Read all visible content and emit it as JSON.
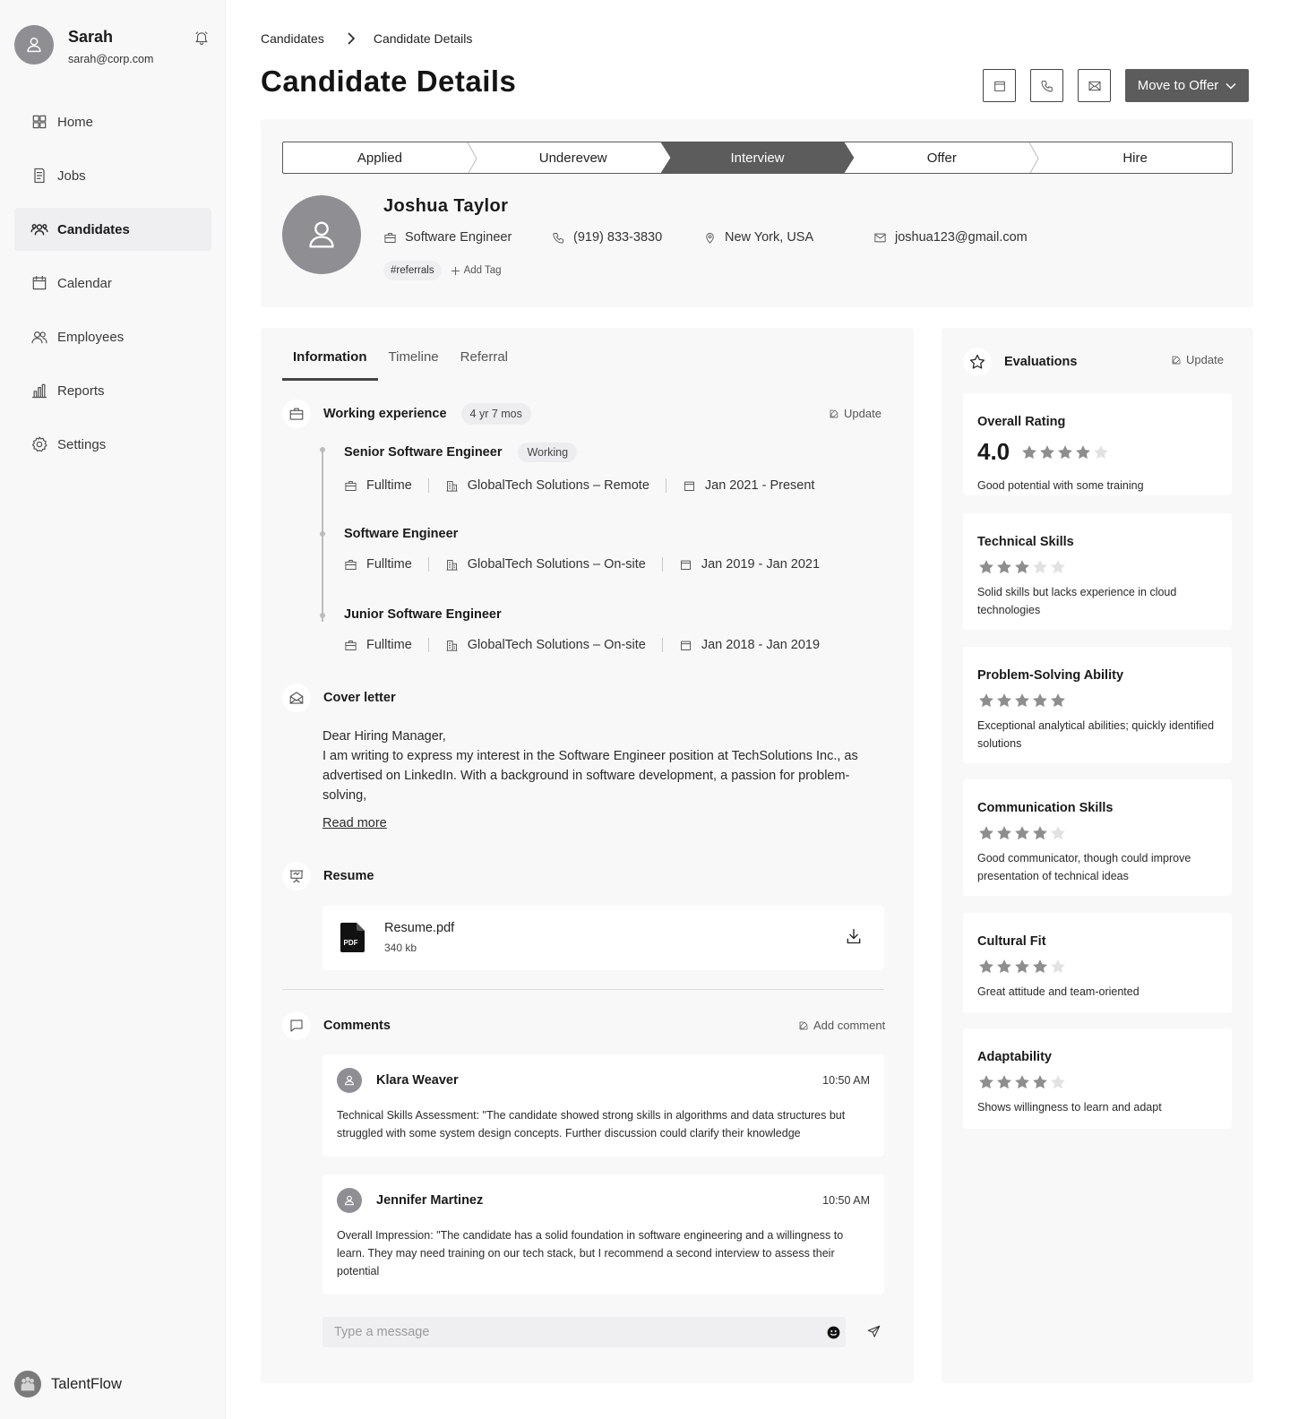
{
  "user": {
    "name": "Sarah",
    "email": "sarah@corp.com",
    "avatar_icon": "user-icon",
    "notification_icon": "bell-icon"
  },
  "nav": {
    "items": [
      {
        "label": "Home",
        "icon": "grid-icon",
        "active": false
      },
      {
        "label": "Jobs",
        "icon": "document-icon",
        "active": false
      },
      {
        "label": "Candidates",
        "icon": "users-icon",
        "active": true
      },
      {
        "label": "Calendar",
        "icon": "calendar-icon",
        "active": false
      },
      {
        "label": "Employees",
        "icon": "people-icon",
        "active": false
      },
      {
        "label": "Reports",
        "icon": "bar-chart-icon",
        "active": false
      },
      {
        "label": "Settings",
        "icon": "gear-icon",
        "active": false
      }
    ]
  },
  "brand": {
    "name": "TalentFlow"
  },
  "breadcrumb": {
    "parent": "Candidates",
    "current": "Candidate Details"
  },
  "page": {
    "title": "Candidate Details"
  },
  "actions": {
    "primary_label": "Move to Offer",
    "icons": [
      "calendar-icon",
      "phone-icon",
      "mail-icon"
    ]
  },
  "stages": {
    "items": [
      "Applied",
      "Underevew",
      "Interview",
      "Offer",
      "Hire"
    ],
    "active": "Interview"
  },
  "candidate": {
    "name": "Joshua Taylor",
    "role": "Software Engineer",
    "phone": "(919) 833-3830",
    "location": "New York, USA",
    "email": "joshua123@gmail.com",
    "tags": [
      "#referrals"
    ],
    "add_tag_label": "Add Tag"
  },
  "tabs": {
    "items": [
      "Information",
      "Timeline",
      "Referral"
    ],
    "active": "Information"
  },
  "experience": {
    "title": "Working experience",
    "duration": "4 yr 7 mos",
    "update_label": "Update",
    "jobs": [
      {
        "title": "Senior Software Engineer",
        "badge": "Working",
        "type": "Fulltime",
        "company": "GlobalTech Solutions – Remote",
        "period": "Jan 2021 - Present"
      },
      {
        "title": "Software Engineer",
        "badge": "",
        "type": "Fulltime",
        "company": "GlobalTech Solutions – On-site",
        "period": "Jan 2019 - Jan 2021"
      },
      {
        "title": "Junior Software Engineer",
        "badge": "",
        "type": "Fulltime",
        "company": "GlobalTech Solutions – On-site",
        "period": "Jan 2018 - Jan 2019"
      }
    ]
  },
  "cover_letter": {
    "title": "Cover letter",
    "greeting": "Dear Hiring Manager,",
    "body": "I am writing to express my interest in the Software Engineer position at TechSolutions Inc., as advertised on LinkedIn. With a background in software development, a passion for problem-solving,",
    "read_more": "Read more"
  },
  "resume": {
    "title": "Resume",
    "file_name": "Resume.pdf",
    "file_size": "340 kb",
    "file_badge": "PDF"
  },
  "comments": {
    "title": "Comments",
    "add_label": "Add comment",
    "items": [
      {
        "author": "Klara Weaver",
        "time": "10:50 AM",
        "text": "Technical Skills Assessment: \"The candidate showed strong skills in algorithms and data structures but struggled with some system design concepts. Further discussion could clarify their knowledge"
      },
      {
        "author": "Jennifer Martinez",
        "time": "10:50 AM",
        "text": "Overall Impression: \"The candidate has a solid foundation in software engineering and a willingness to learn. They may need training on our tech stack, but I recommend a second interview to assess their potential"
      }
    ],
    "input_placeholder": "Type a message"
  },
  "evaluations": {
    "title": "Evaluations",
    "update_label": "Update",
    "overall": {
      "title": "Overall Rating",
      "score": "4.0",
      "stars": 4,
      "desc": "Good potential with some training"
    },
    "items": [
      {
        "title": "Technical Skills",
        "stars": 3,
        "desc": "Solid skills but lacks experience in cloud technologies"
      },
      {
        "title": "Problem-Solving Ability",
        "stars": 5,
        "desc": "Exceptional analytical abilities; quickly identified solutions"
      },
      {
        "title": "Communication Skills",
        "stars": 4,
        "desc": "Good communicator, though could improve presentation of technical ideas"
      },
      {
        "title": "Cultural Fit",
        "stars": 4,
        "desc": "Great attitude and team-oriented"
      },
      {
        "title": "Adaptability",
        "stars": 4,
        "desc": "Shows willingness to learn and adapt"
      }
    ]
  },
  "colors": {
    "accent": "#5c5c5c",
    "panel": "#f8f8f9",
    "star_filled": "#8e8e8e",
    "star_empty": "#e2e2e2"
  }
}
